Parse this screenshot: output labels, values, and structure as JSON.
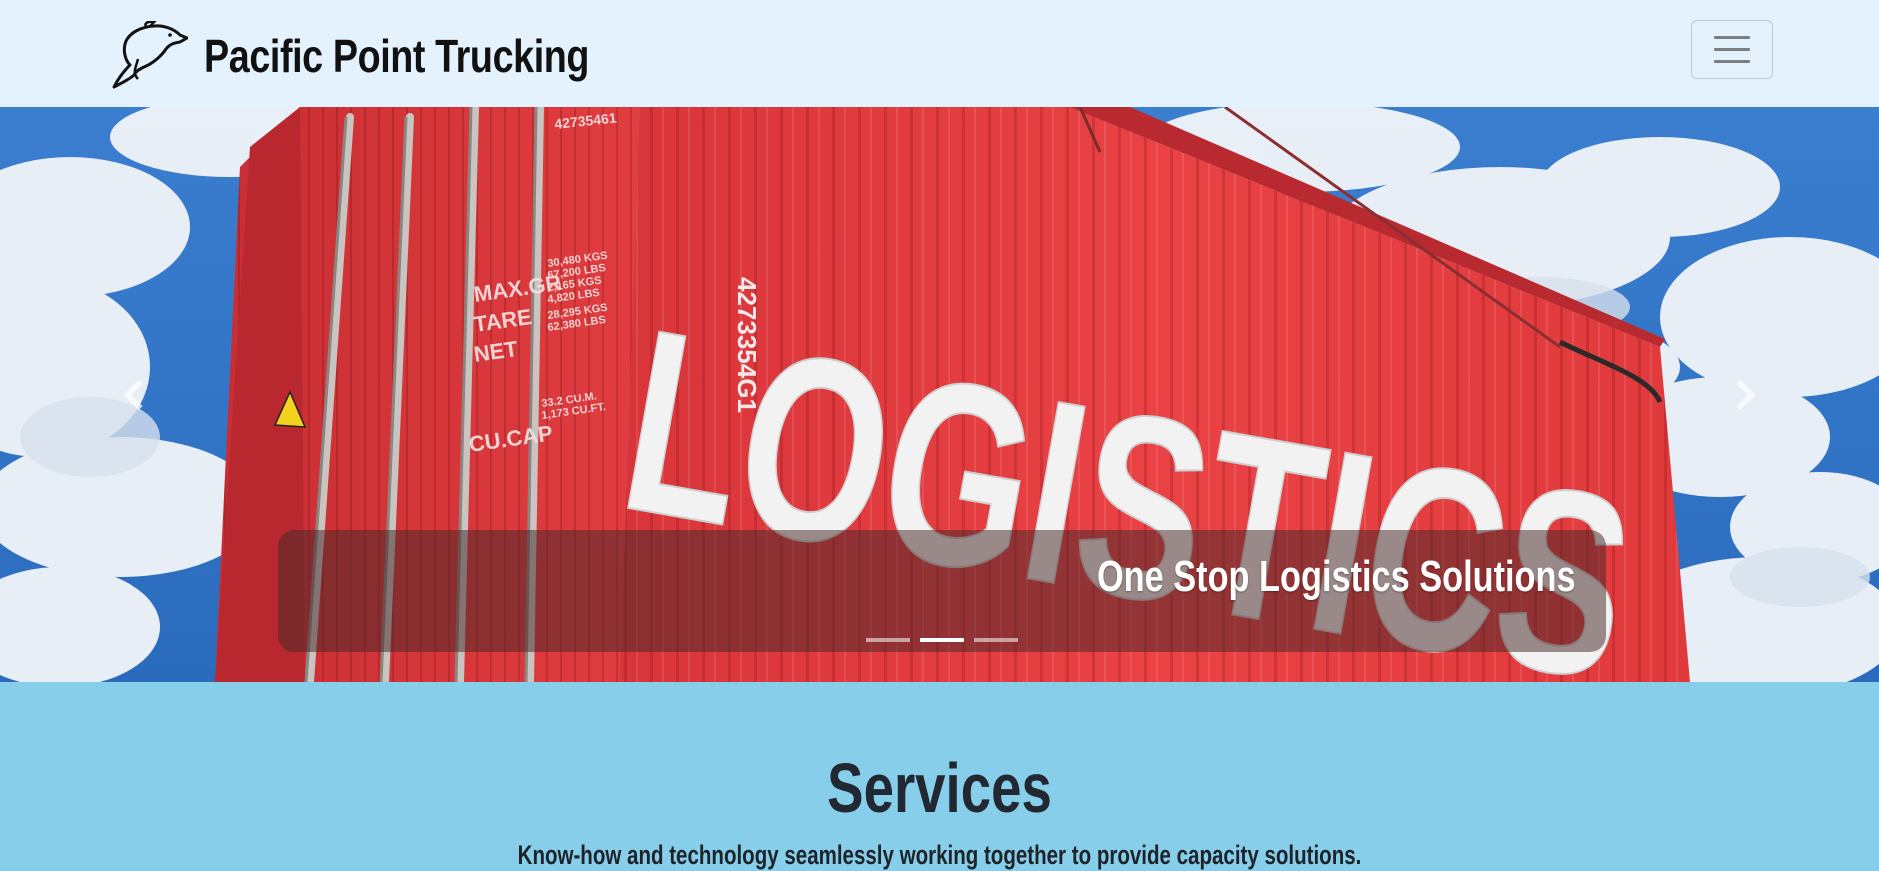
{
  "navbar": {
    "brand_name": "Pacific Point Trucking",
    "logo_icon": "dolphin-icon",
    "toggler_icon": "hamburger-menu-icon"
  },
  "carousel": {
    "caption": "One Stop Logistics Solutions",
    "slide_count": 3,
    "active_slide": 2,
    "prev_icon": "chevron-left-icon",
    "next_icon": "chevron-right-icon",
    "image": {
      "description_label": "LOGISTICS",
      "container_code": "4273354G1",
      "container_code_top": "42735461",
      "panel_lines": [
        "MAX.GR",
        "TARE",
        "NET",
        "CU.CAP"
      ],
      "weights": [
        "30,480 KGS",
        "67,200 LBS",
        "2,165 KGS",
        "4,820 LBS",
        "28,295 KGS",
        "62,380 LBS"
      ],
      "capacity": [
        "33.2 CU.M.",
        "1,173 CU.FT."
      ]
    }
  },
  "services": {
    "title": "Services",
    "subtitle": "Know-how and technology seamlessly working together to provide capacity solutions."
  },
  "colors": {
    "navbar_bg": "#e3f2fd",
    "section_bg": "#87ceeb",
    "container_red": "#e2383a",
    "sky_blue": "#2f74c7"
  }
}
